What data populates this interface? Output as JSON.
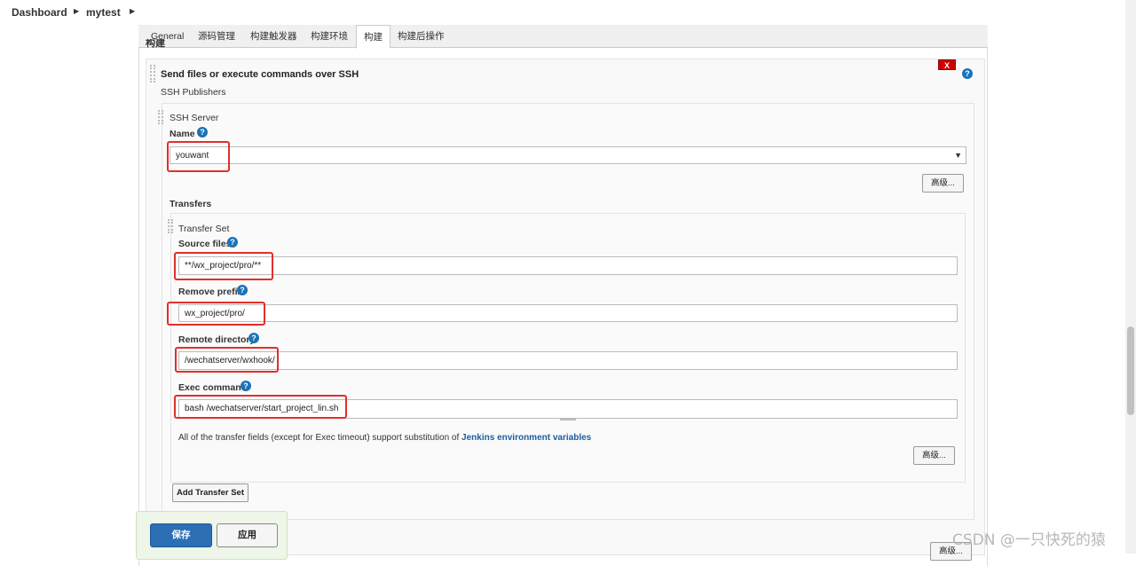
{
  "breadcrumb": {
    "home": "Dashboard",
    "job": "mytest"
  },
  "tabs": [
    {
      "label": "General"
    },
    {
      "label": "源码管理"
    },
    {
      "label": "构建触发器"
    },
    {
      "label": "构建环境"
    },
    {
      "label": "构建"
    },
    {
      "label": "构建后操作"
    }
  ],
  "active_tab": "构建",
  "section_heading": "构建",
  "builder": {
    "title": "Send files or execute commands over SSH",
    "delete_label": "X",
    "publishers_label": "SSH Publishers",
    "server": {
      "label": "SSH Server",
      "name_label": "Name",
      "name_value": "youwant",
      "advanced_label": "高级..."
    },
    "transfers_label": "Transfers",
    "transfer_set": {
      "label": "Transfer Set",
      "source_files_label": "Source files",
      "source_files_value": "**/wx_project/pro/**",
      "remove_prefix_label": "Remove prefix",
      "remove_prefix_value": "wx_project/pro/",
      "remote_directory_label": "Remote directory",
      "remote_directory_value": "/wechatserver/wxhook/",
      "exec_command_label": "Exec command",
      "exec_command_value": "bash /wechatserver/start_project_lin.sh",
      "note_prefix": "All of the transfer fields (except for Exec timeout) support substitution of ",
      "note_link": "Jenkins environment variables",
      "advanced_label": "高级..."
    },
    "add_transfer_set_label": "Add Transfer Set",
    "outer_advanced_label": "高级..."
  },
  "help_icon_text": "?",
  "save_label": "保存",
  "apply_label": "应用",
  "watermark": "CSDN @一只快死的猿",
  "colors": {
    "highlight": "#e0302b",
    "primary": "#2d6fb4",
    "delete": "#cc0000",
    "help": "#1a73b8"
  }
}
